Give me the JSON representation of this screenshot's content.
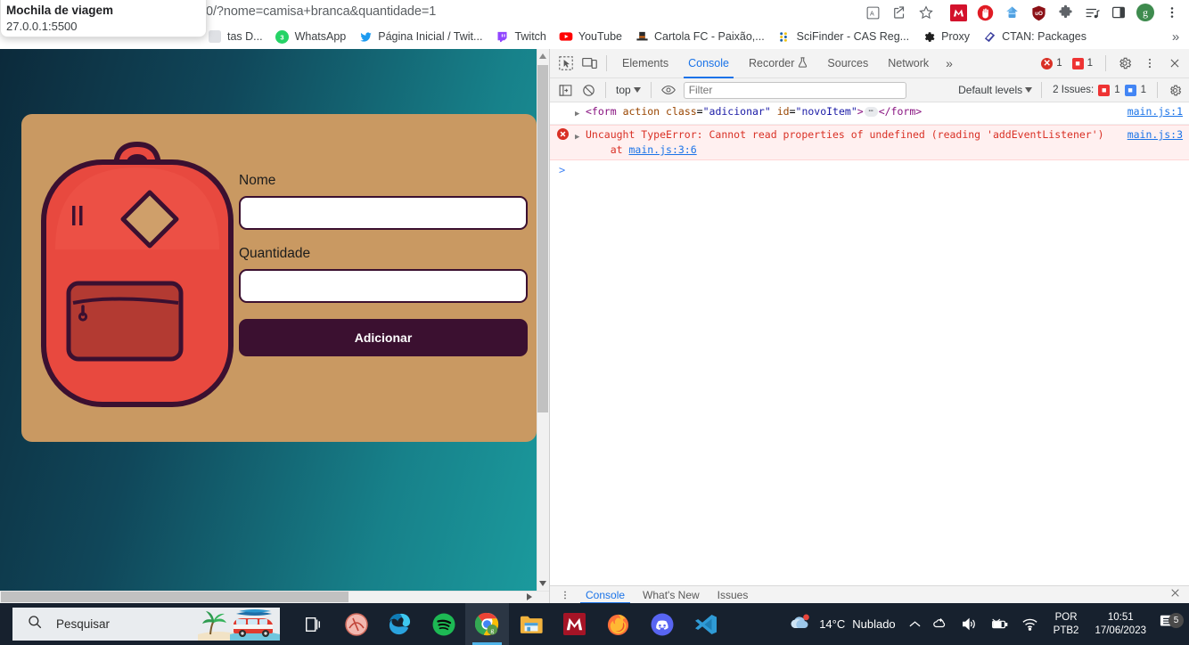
{
  "browser": {
    "omnibox_value": "0/?nome=camisa+branca&quantidade=1",
    "tab_tooltip": {
      "title": "Mochila de viagem",
      "url": "27.0.0.1:5500"
    },
    "toolbar_icons": [
      {
        "name": "translate-icon"
      },
      {
        "name": "share-icon"
      },
      {
        "name": "bookmark-star-icon"
      },
      {
        "name": "mercado-livre-extension-icon"
      },
      {
        "name": "adblock-extension-icon"
      },
      {
        "name": "honey-extension-icon"
      },
      {
        "name": "ublock-origin-extension-icon"
      },
      {
        "name": "extensions-puzzle-icon"
      },
      {
        "name": "media-playlist-icon"
      },
      {
        "name": "side-panel-icon"
      },
      {
        "name": "profile-avatar",
        "label": "g"
      },
      {
        "name": "chrome-menu-icon"
      }
    ],
    "bookmarks": [
      {
        "label": "tas D...",
        "icon": "generic-favicon"
      },
      {
        "label": "WhatsApp",
        "icon": "whatsapp-icon",
        "badge": "3"
      },
      {
        "label": "Página Inicial / Twit...",
        "icon": "twitter-icon"
      },
      {
        "label": "Twitch",
        "icon": "twitch-icon"
      },
      {
        "label": "YouTube",
        "icon": "youtube-icon"
      },
      {
        "label": "Cartola FC - Paixão,...",
        "icon": "cartola-icon"
      },
      {
        "label": "SciFinder - CAS Reg...",
        "icon": "scifinder-icon"
      },
      {
        "label": "Proxy",
        "icon": "gear-icon"
      },
      {
        "label": "CTAN: Packages",
        "icon": "ctan-icon"
      }
    ],
    "bookmarks_overflow": "»"
  },
  "page": {
    "form": {
      "name_label": "Nome",
      "name_value": "",
      "quantity_label": "Quantidade",
      "quantity_value": "",
      "submit_label": "Adicionar"
    },
    "illustration": "backpack-illustration",
    "colors": {
      "card_bg": "#c99962",
      "accent_dark": "#3b1030",
      "backpack_red": "#e8493f",
      "backpack_pocket": "#b33a32",
      "page_gradient_start": "#0c2a3b",
      "page_gradient_end": "#1b9a9d"
    }
  },
  "devtools": {
    "tabs": [
      {
        "label": "Elements",
        "active": false
      },
      {
        "label": "Console",
        "active": true
      },
      {
        "label": "Recorder",
        "active": false,
        "icon": "flask-icon"
      },
      {
        "label": "Sources",
        "active": false
      },
      {
        "label": "Network",
        "active": false
      }
    ],
    "tabs_overflow": "»",
    "error_count": "1",
    "warning_count": "1",
    "context": "top",
    "filter_placeholder": "Filter",
    "levels_label": "Default levels",
    "issues_label": "2 Issues:",
    "issues_error_count": "1",
    "issues_info_count": "1",
    "messages": [
      {
        "type": "log",
        "parts": {
          "tag_open": "<form",
          "attr1": "action",
          "attr2": "class",
          "val2": "\"adicionar\"",
          "attr3": "id",
          "val3": "\"novoItem\"",
          "tag_close": ">",
          "ellipsis": "⋯",
          "tag_end": "</form>"
        },
        "source": "main.js:1"
      },
      {
        "type": "error",
        "text": "Uncaught TypeError: Cannot read properties of undefined (reading 'addEventListener')",
        "stack_prefix": "    at ",
        "stack_link": "main.js:3:6",
        "source": "main.js:3"
      }
    ],
    "prompt": ">",
    "drawer_tabs": [
      {
        "label": "Console",
        "active": true
      },
      {
        "label": "What's New",
        "active": false
      },
      {
        "label": "Issues",
        "active": false
      }
    ]
  },
  "taskbar": {
    "search_placeholder": "Pesquisar",
    "apps": [
      {
        "name": "task-view-icon"
      },
      {
        "name": "adobe-app-icon"
      },
      {
        "name": "microsoft-edge-icon"
      },
      {
        "name": "spotify-icon"
      },
      {
        "name": "google-chrome-icon"
      },
      {
        "name": "file-explorer-icon"
      },
      {
        "name": "mercado-livre-app-icon"
      },
      {
        "name": "firefox-icon"
      },
      {
        "name": "discord-icon"
      },
      {
        "name": "vscode-icon"
      }
    ],
    "tray": {
      "weather_temp": "14°C",
      "weather_desc": "Nublado",
      "language_line1": "POR",
      "language_line2": "PTB2",
      "time": "10:51",
      "date": "17/06/2023",
      "notification_count": "5",
      "icons": [
        "chevron-up-icon",
        "onedrive-icon",
        "volume-icon",
        "battery-icon",
        "wifi-icon"
      ]
    }
  }
}
